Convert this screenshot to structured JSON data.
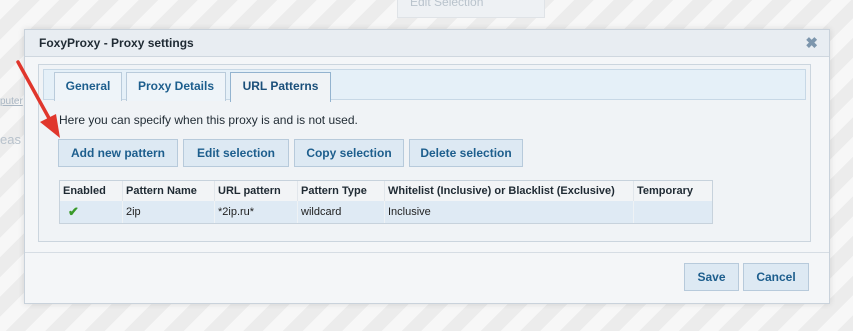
{
  "background": {
    "edit_selection_ghost": "Edit Selection",
    "left_fragment_1": "puter",
    "left_fragment_2": "eas"
  },
  "dialog": {
    "title": "FoxyProxy - Proxy settings",
    "close_glyph": "✖"
  },
  "tabs": [
    {
      "label": "General",
      "active": false
    },
    {
      "label": "Proxy Details",
      "active": false
    },
    {
      "label": "URL Patterns",
      "active": true
    }
  ],
  "url_patterns": {
    "intro": "Here you can specify when this proxy is and is not used.",
    "buttons": {
      "add": "Add new pattern",
      "edit": "Edit selection",
      "copy": "Copy selection",
      "delete": "Delete selection"
    },
    "table": {
      "columns": [
        "Enabled",
        "Pattern Name",
        "URL pattern",
        "Pattern Type",
        "Whitelist (Inclusive) or Blacklist (Exclusive)",
        "Temporary"
      ],
      "rows": [
        {
          "enabled_icon": "check-icon",
          "enabled_glyph": "✔",
          "pattern_name": "2ip",
          "url_pattern": "*2ip.ru*",
          "pattern_type": "wildcard",
          "list_type": "Inclusive",
          "temporary": ""
        }
      ]
    }
  },
  "footer": {
    "save": "Save",
    "cancel": "Cancel"
  },
  "colors": {
    "accent_text": "#1d5e8d",
    "button_bg": "#dde9f3",
    "selected_row_bg": "#dfeaf4",
    "arrow": "#e0362c",
    "check": "#3a9a2a"
  }
}
